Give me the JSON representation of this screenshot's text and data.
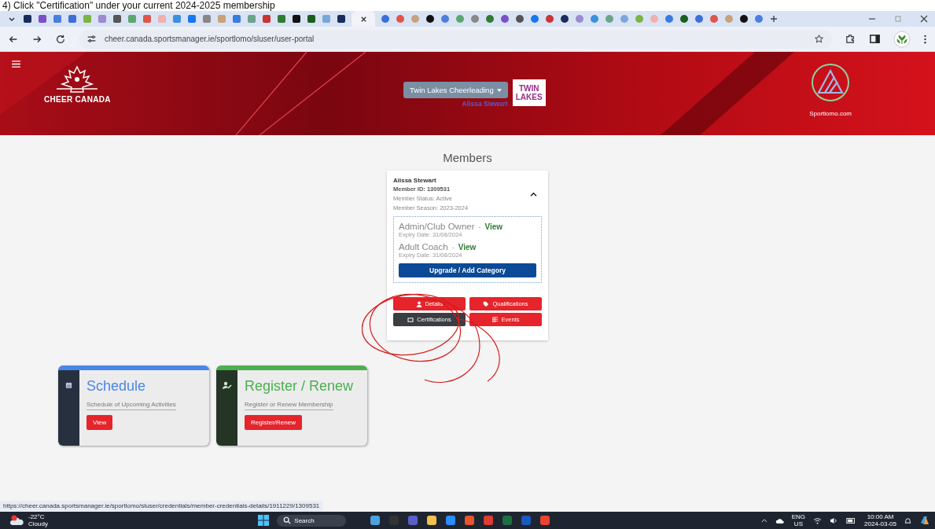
{
  "caption": "4) Click \"Certification\" under your current 2024-2025 membership",
  "browser": {
    "url": "cheer.canada.sportsmanager.ie/sportlomo/sluser/user-portal"
  },
  "header": {
    "org": "CHEER CANADA",
    "club_menu": "Twin Lakes Cheerleading",
    "user": "Alissa Stewart",
    "club_logo": [
      "TWIN",
      "LAKES"
    ],
    "provider": "Sportlomo.com"
  },
  "members": {
    "title": "Members",
    "name": "Alissa Stewart",
    "member_id": "Member ID: 1309531",
    "status": "Member Status: Active",
    "season": "Member Season: 2023-2024",
    "expanded": true,
    "categories": [
      {
        "name": "Admin/Club Owner",
        "separator": "-",
        "link": "View",
        "expiry": "Expiry Date: 31/08/2024"
      },
      {
        "name": "Adult Coach",
        "separator": "-",
        "link": "View",
        "expiry": "Expiry Date: 31/08/2024"
      }
    ],
    "upgrade": "Upgrade / Add Category",
    "actions": [
      {
        "label": "Details",
        "kind": "person",
        "selected": false
      },
      {
        "label": "Qualifications",
        "kind": "tag",
        "selected": false
      },
      {
        "label": "Certifications",
        "kind": "card",
        "selected": true
      },
      {
        "label": "Events",
        "kind": "list",
        "selected": false
      }
    ]
  },
  "tiles": [
    {
      "title": "Schedule",
      "subtitle": "Schedule of Upcoming Activities",
      "button": "View",
      "color": "#4a86e8",
      "kind": "calendar"
    },
    {
      "title": "Register / Renew",
      "subtitle": "Register or Renew Membership",
      "button": "Register/Renew",
      "color": "#4caf50",
      "kind": "person"
    }
  ],
  "status_url": "https://cheer.canada.sportsmanager.ie/sportlomo/sluser/credentials/member-credentials-details/1911229/1309531",
  "taskbar": {
    "temperature": "-22°C",
    "weather": "Cloudy",
    "search": "Search",
    "language": "ENG",
    "region": "US",
    "time": "10:00 AM",
    "date": "2024-03-05"
  }
}
